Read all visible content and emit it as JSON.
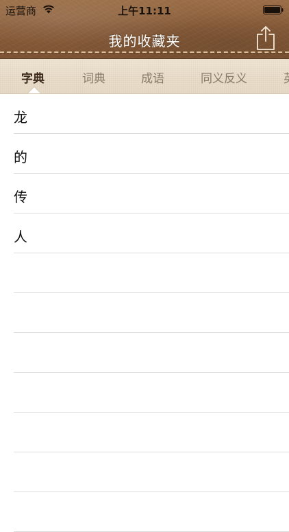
{
  "status_bar": {
    "carrier": "运营商",
    "time": "上午11:11"
  },
  "nav": {
    "title": "我的收藏夹"
  },
  "tabs": [
    {
      "label": "字典",
      "active": true
    },
    {
      "label": "词典",
      "active": false
    },
    {
      "label": "成语",
      "active": false
    },
    {
      "label": "同义反义",
      "active": false
    },
    {
      "label": "英",
      "active": false
    }
  ],
  "list": {
    "items": [
      "龙",
      "的",
      "传",
      "人",
      "",
      "",
      "",
      "",
      "",
      "",
      ""
    ]
  },
  "icons": {
    "wifi": "wifi-icon",
    "battery": "battery-icon",
    "share": "share-icon"
  },
  "colors": {
    "header_leather": "#8a5e3b",
    "tab_background": "#eadecb",
    "tab_active_text": "#3d2a1a",
    "tab_inactive_text": "#8a7a68",
    "separator": "#dcdcdc"
  }
}
